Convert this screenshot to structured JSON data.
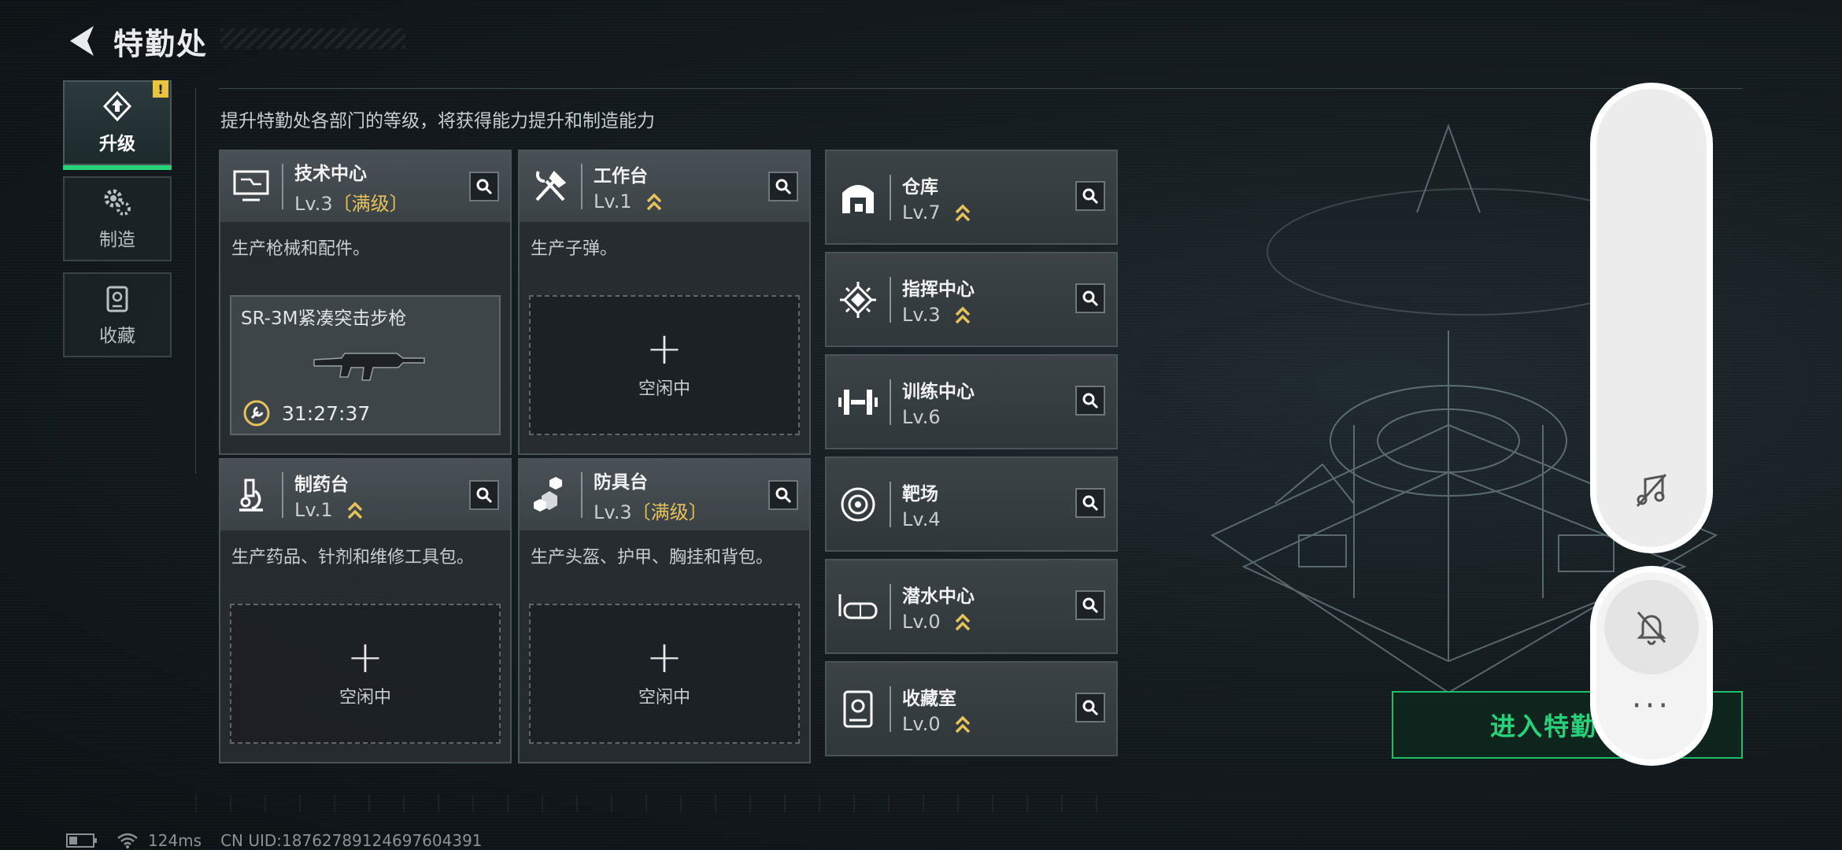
{
  "header": {
    "title": "特勤处"
  },
  "tabs": [
    {
      "label": "升级",
      "icon": "upgrade-icon",
      "active": true,
      "badge": "!"
    },
    {
      "label": "制造",
      "icon": "gears-icon",
      "active": false
    },
    {
      "label": "收藏",
      "icon": "collection-icon",
      "active": false
    }
  ],
  "subtitle": "提升特勤处各部门的等级，将获得能力提升和制造能力",
  "big_cards": [
    {
      "name": "技术中心",
      "level": "Lv.3",
      "maxed": "〔满级〕",
      "desc": "生产枪械和配件。",
      "craft": {
        "item": "SR-3M紧凑突击步枪",
        "timer": "31:27:37"
      }
    },
    {
      "name": "工作台",
      "level": "Lv.1",
      "desc": "生产子弹。",
      "slot": {
        "plus": "+",
        "status": "空闲中"
      }
    },
    {
      "name": "制药台",
      "level": "Lv.1",
      "desc": "生产药品、针剂和维修工具包。",
      "slot": {
        "plus": "+",
        "status": "空闲中"
      }
    },
    {
      "name": "防具台",
      "level": "Lv.3",
      "maxed": "〔满级〕",
      "desc": "生产头盔、护甲、胸挂和背包。",
      "slot": {
        "plus": "+",
        "status": "空闲中"
      }
    }
  ],
  "small_cards": [
    {
      "name": "仓库",
      "level": "Lv.7",
      "upgradable": true
    },
    {
      "name": "指挥中心",
      "level": "Lv.3",
      "upgradable": true
    },
    {
      "name": "训练中心",
      "level": "Lv.6",
      "upgradable": false
    },
    {
      "name": "靶场",
      "level": "Lv.4",
      "upgradable": false
    },
    {
      "name": "潜水中心",
      "level": "Lv.0",
      "upgradable": true
    },
    {
      "name": "收藏室",
      "level": "Lv.0",
      "upgradable": true
    }
  ],
  "enter_button": {
    "label": "进入特勤"
  },
  "overlay": {
    "more": "···"
  },
  "footer": {
    "ping": "124ms",
    "uid": "CN UID:18762789124697604391"
  },
  "colors": {
    "accent_green": "#27d27a",
    "maxed_gold": "#e6c25a",
    "badge_yellow": "#e8c440"
  }
}
